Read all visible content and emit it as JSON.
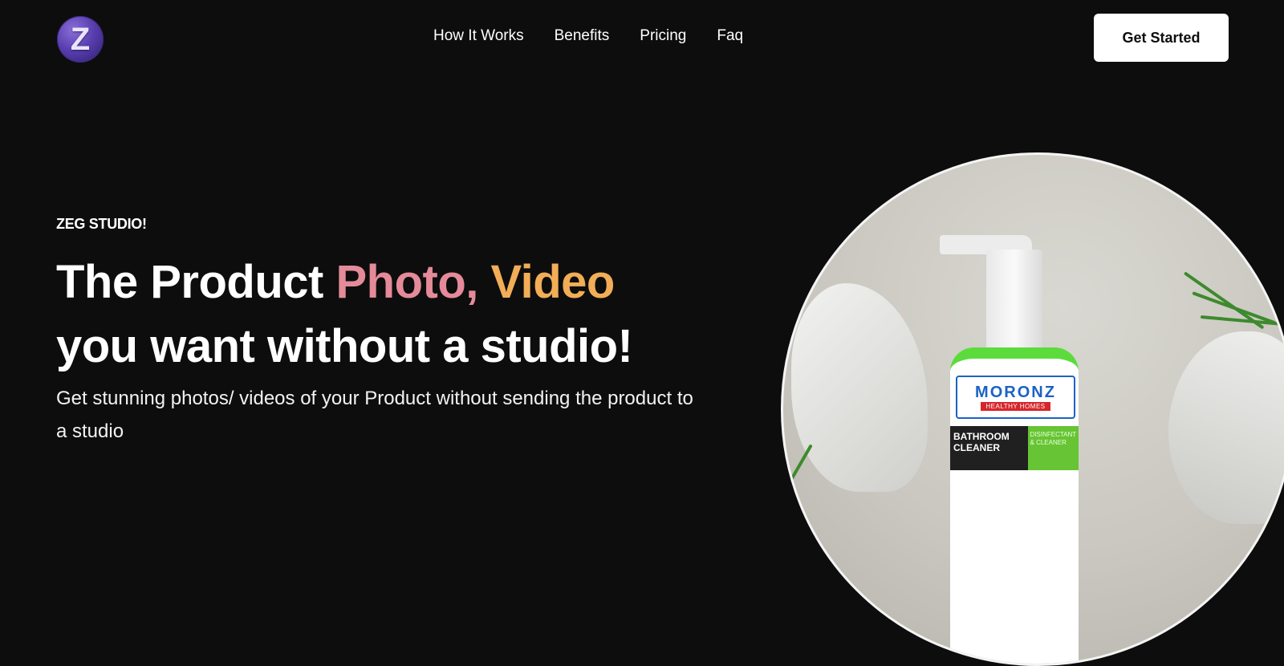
{
  "header": {
    "logo_letter": "Z",
    "nav": [
      "How It Works",
      "Benefits",
      "Pricing",
      "Faq"
    ],
    "cta_label": "Get Started"
  },
  "hero": {
    "eyebrow": "ZEG STUDIO!",
    "headline_part1": "The Product ",
    "headline_highlight1": "Photo,",
    "headline_highlight2": " Video",
    "headline_line2": "you want without a studio!",
    "subtext": "Get stunning photos/ videos of your Product without sending the product to a studio"
  },
  "product_image": {
    "brand": "MORONZ",
    "brand_tag": "HEALTHY HOMES",
    "product_name": "BATHROOM CLEANER",
    "product_side": "DISINFECTANT & CLEANER"
  },
  "colors": {
    "background": "#0d0d0d",
    "highlight_pink": "#e58a99",
    "highlight_orange": "#f2ad57",
    "cta_bg": "#ffffff"
  }
}
